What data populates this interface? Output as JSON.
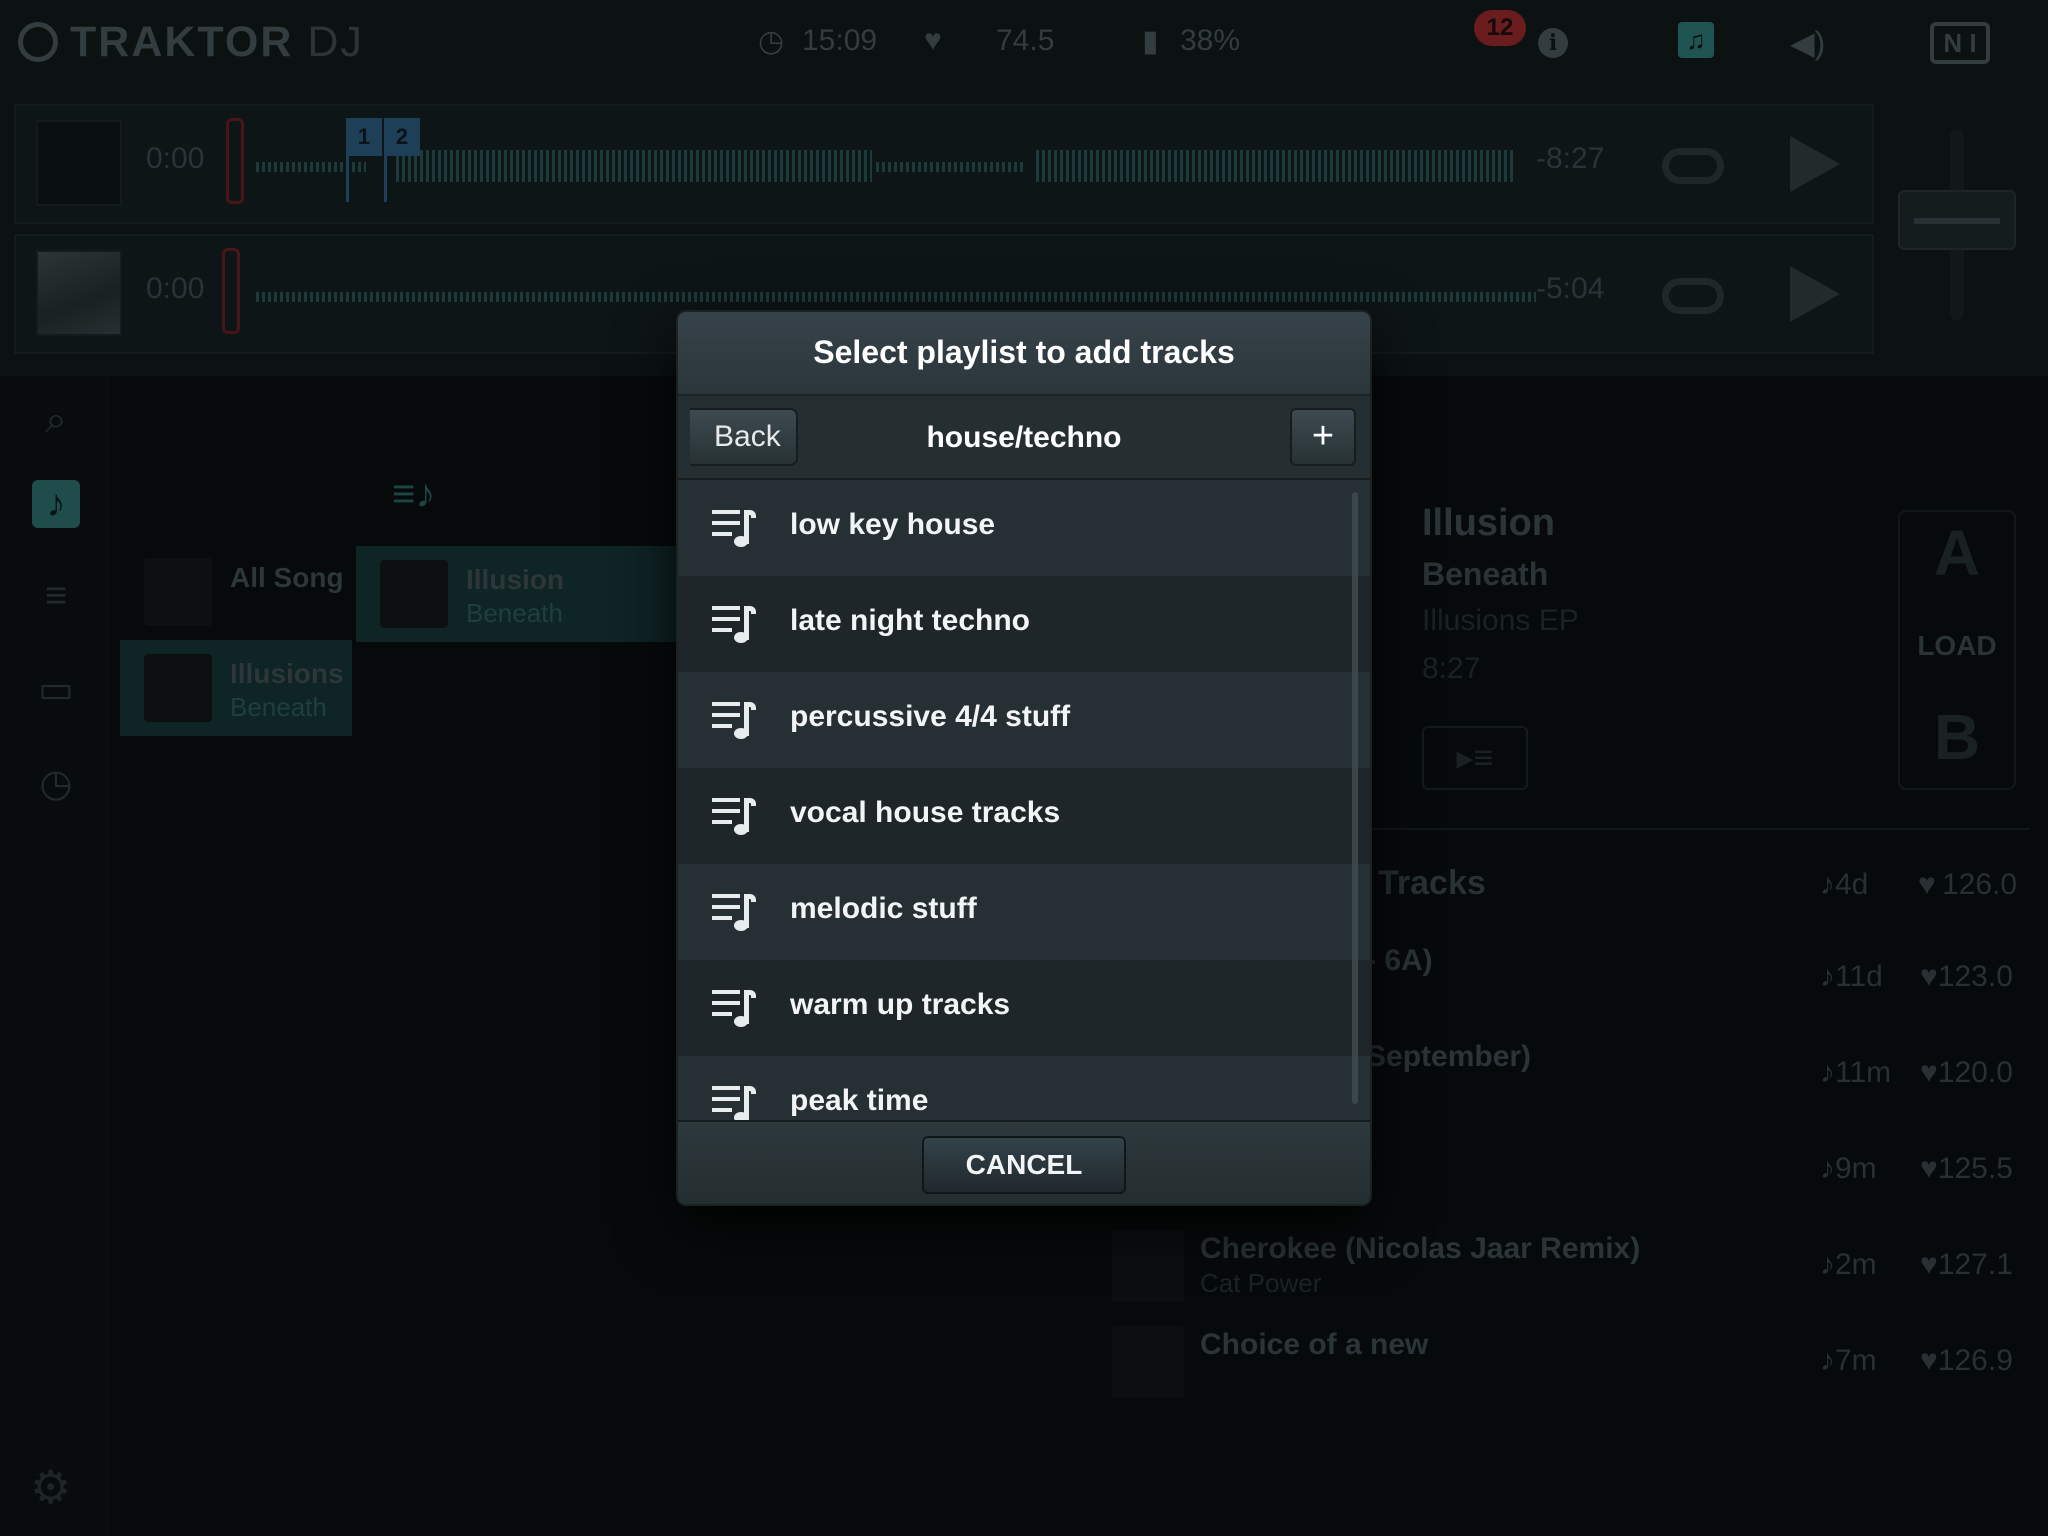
{
  "topbar": {
    "app_name": "TRAKTOR",
    "app_suffix": "DJ",
    "clock": "15:09",
    "bpm": "74.5",
    "battery": "38%",
    "notifications": "12",
    "icons": [
      "clock-icon",
      "heart-bpm-icon",
      "battery-icon",
      "info-icon",
      "music-note-icon",
      "speaker-icon",
      "ni-logo"
    ]
  },
  "decks": {
    "a": {
      "time": "0:00",
      "remain": "-8:27",
      "cues": [
        "1",
        "2"
      ]
    },
    "b": {
      "time": "0:00",
      "remain": "-5:04"
    }
  },
  "browser": {
    "col1": [
      {
        "title": "All Song",
        "subtitle": ""
      },
      {
        "title": "Illusions",
        "subtitle": "Beneath"
      }
    ],
    "col2": [
      {
        "title": "Illusion",
        "subtitle": "Beneath"
      }
    ]
  },
  "detail": {
    "title": "Illusion",
    "artist": "Beneath",
    "album": "Illusions EP",
    "length": "8:27",
    "load_a": "A",
    "load_label": "LOAD",
    "load_b": "B"
  },
  "tracks": {
    "header": "Tracks",
    "header_age": "♪4d",
    "header_bpm": "126.0",
    "rows": [
      {
        "name": "- 6A)",
        "artist": "",
        "age": "♪11d",
        "bpm": "123.0"
      },
      {
        "name": "September)",
        "artist": "",
        "age": "♪11m",
        "bpm": "120.0"
      },
      {
        "name": "",
        "artist": "",
        "age": "♪9m",
        "bpm": "125.5"
      },
      {
        "name": "Cherokee (Nicolas Jaar Remix)",
        "artist": "Cat Power",
        "age": "♪2m",
        "bpm": "127.1"
      },
      {
        "name": "Choice of a new",
        "artist": "",
        "age": "♪7m",
        "bpm": "126.9"
      }
    ]
  },
  "modal": {
    "title": "Select playlist to add tracks",
    "back_label": "Back",
    "folder": "house/techno",
    "add_label": "+",
    "cancel_label": "CANCEL",
    "playlists": [
      "low key house",
      "late night techno",
      "percussive 4/4 stuff",
      "vocal house tracks",
      "melodic stuff",
      "warm up tracks",
      "peak time"
    ]
  }
}
